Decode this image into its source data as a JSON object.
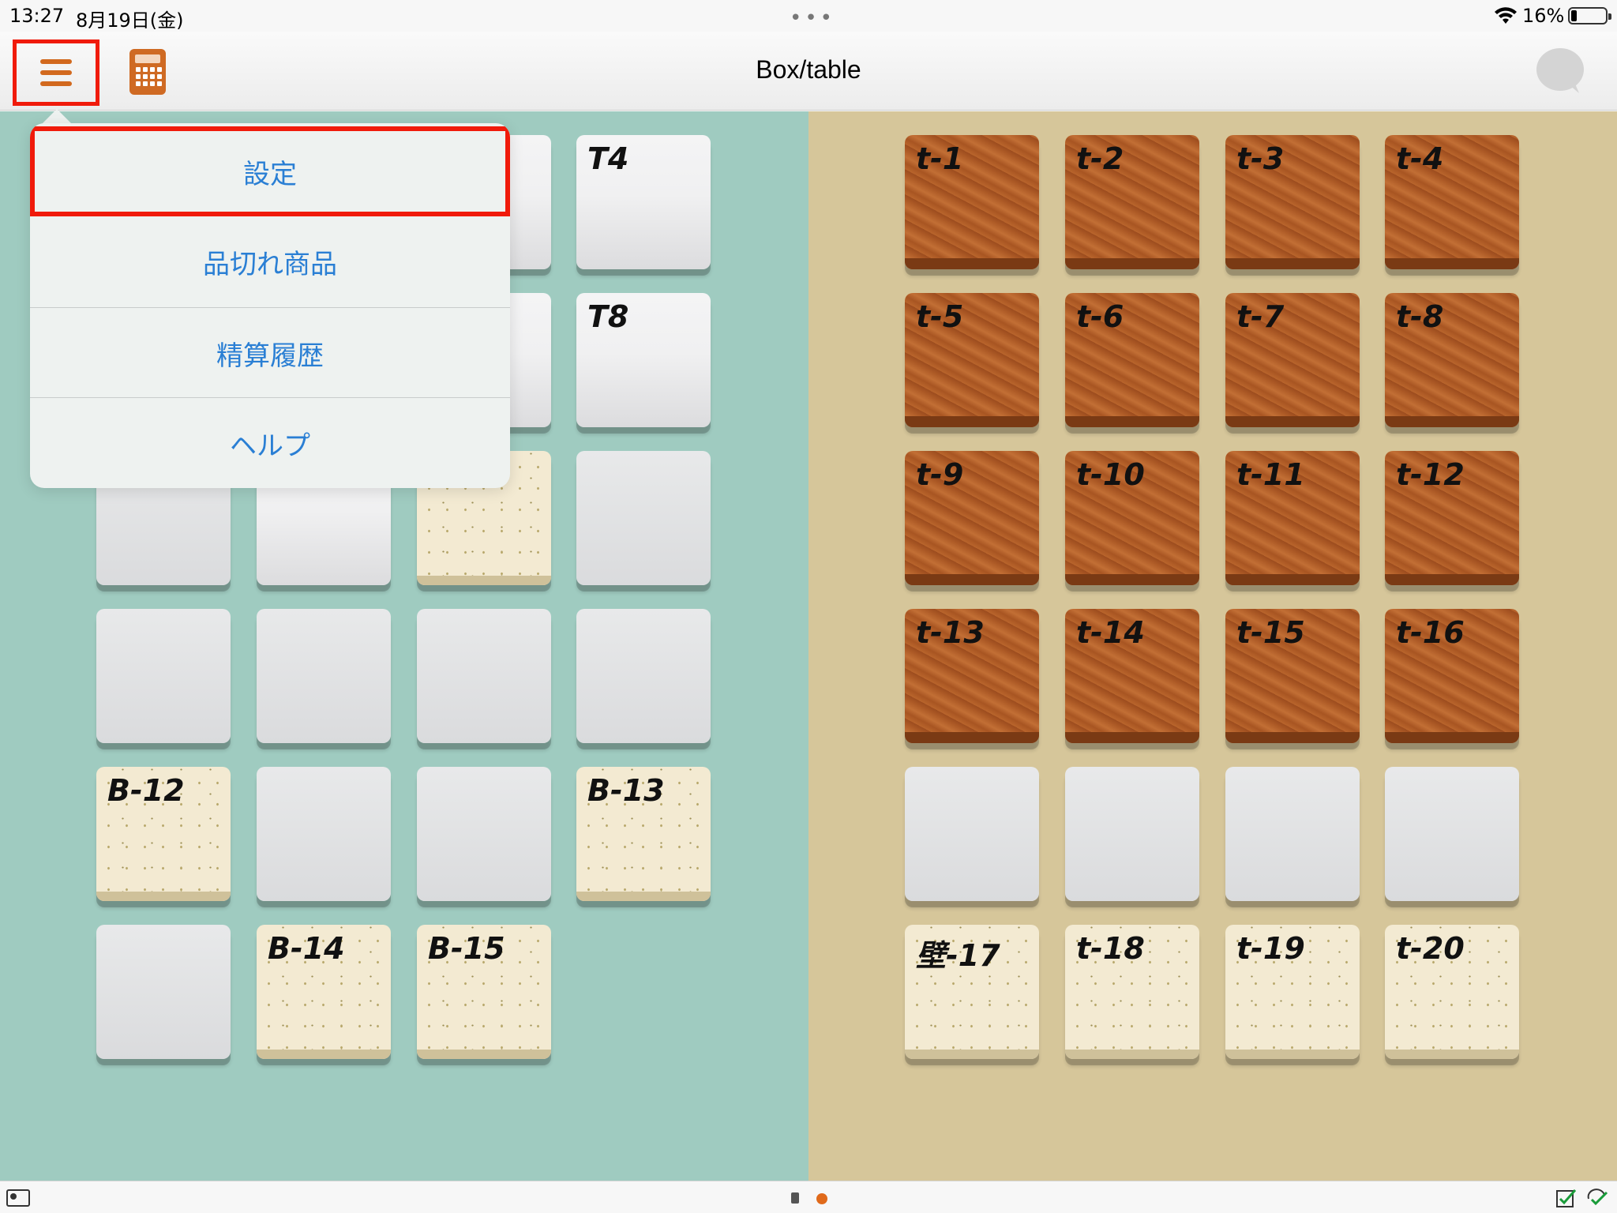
{
  "status_bar": {
    "time": "13:27",
    "date": "8月19日(金)",
    "dots": "•••",
    "battery_percent": "16%"
  },
  "nav": {
    "title": "Box/table"
  },
  "menu": {
    "items": [
      {
        "label": "設定"
      },
      {
        "label": "品切れ商品"
      },
      {
        "label": "精算履歴"
      },
      {
        "label": "ヘルプ"
      }
    ]
  },
  "left_tiles": {
    "t_c3r0": "T4",
    "t_c3r1": "T8",
    "t_c0r4": "B-12",
    "t_c3r4": "B-13",
    "t_c1r5": "B-14",
    "t_c2r5": "B-15"
  },
  "right_tiles": {
    "r0": [
      "t-1",
      "t-2",
      "t-3",
      "t-4"
    ],
    "r1": [
      "t-5",
      "t-6",
      "t-7",
      "t-8"
    ],
    "r2": [
      "t-9",
      "t-10",
      "t-11",
      "t-12"
    ],
    "r3": [
      "t-13",
      "t-14",
      "t-15",
      "t-16"
    ],
    "r5": [
      "壁-17",
      "t-18",
      "t-19",
      "t-20"
    ]
  },
  "colors": {
    "accent_orange": "#d2691e",
    "highlight_red": "#f01b0b",
    "menu_text_blue": "#2a7fd4",
    "left_bg": "#9fcbc0",
    "right_bg": "#d6c69a"
  }
}
